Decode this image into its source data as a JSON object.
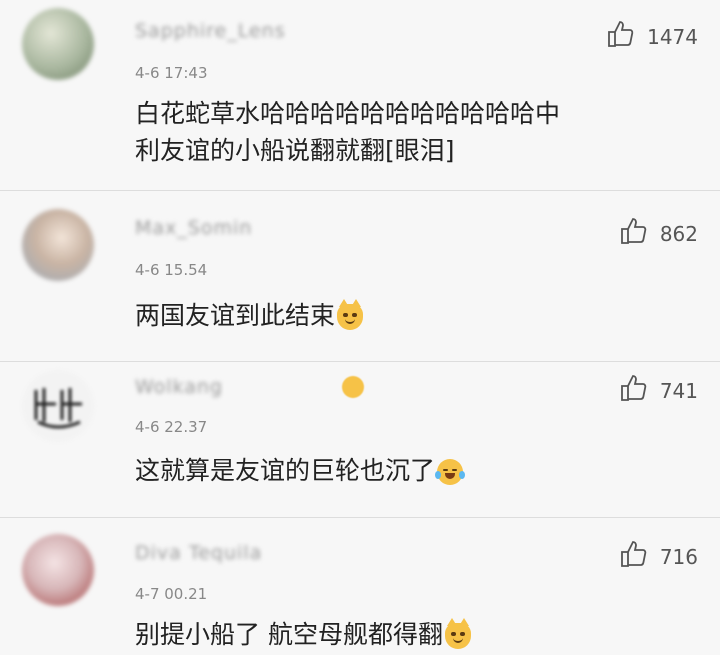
{
  "comments": [
    {
      "username": "Sapphire_Lens",
      "time": "4-6 17:43",
      "text_line1": "白花蛇草水哈哈哈哈哈哈哈哈哈哈哈中",
      "text_line2": "利友谊的小船说翻就翻[眼泪]",
      "likes": "1474",
      "avatar_colors": [
        "#c9cdb8",
        "#8f9f88"
      ]
    },
    {
      "username": "Max_Somin",
      "time": "4-6 15.54",
      "text": "两国友谊到此结束",
      "emoji": "cat-face-emoji",
      "likes": "862",
      "avatar_colors": [
        "#e5d8cc",
        "#b7c2cc"
      ]
    },
    {
      "username": "Wolkang",
      "time": "4-6 22.37",
      "text": "这就算是友谊的巨轮也沉了",
      "emoji": "laughing-tears-emoji",
      "likes": "741",
      "avatar_colors": [
        "#f3f3f3",
        "#222222"
      ]
    },
    {
      "username": "Diva Tequila",
      "time": "4-7 00.21",
      "text": "别提小船了 航空母舰都得翻",
      "emoji": "cat-face-emoji",
      "likes": "716",
      "avatar_colors": [
        "#e7cfd2",
        "#a33c3c"
      ]
    }
  ],
  "icons": {
    "like": "thumbs-up-icon"
  },
  "colors": {
    "background": "#f7f7f7",
    "text": "#222222",
    "meta": "#888888",
    "emoji": "#f6c247"
  }
}
